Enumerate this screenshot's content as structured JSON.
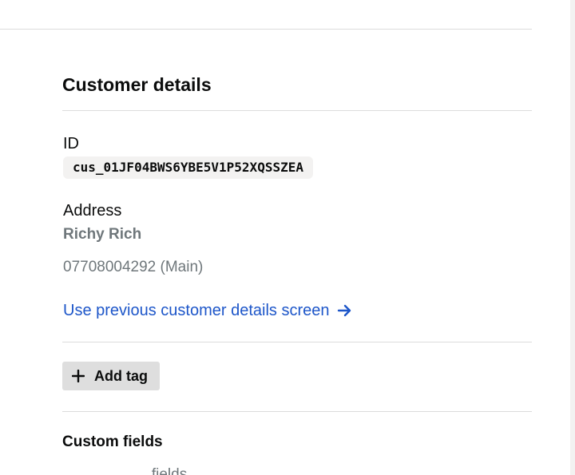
{
  "customer_details": {
    "heading": "Customer details",
    "id_label": "ID",
    "id_value": "cus_01JF04BWS6YBE5V1P52XQSSZEA",
    "address_label": "Address",
    "address_name": "Richy Rich",
    "address_phone": "07708004292 (Main)",
    "previous_screen_link": "Use previous customer details screen"
  },
  "tags": {
    "add_tag_label": "Add tag"
  },
  "custom_fields": {
    "heading": "Custom fields",
    "partial_text": "…… … …… fields … … …"
  },
  "icons": {
    "link_arrow": "arrow-right-icon",
    "add": "plus-icon"
  },
  "colors": {
    "link": "#1d56c9",
    "muted_text": "#6f777b",
    "button_bg": "#dedede",
    "code_bg": "#f3f2f1"
  }
}
